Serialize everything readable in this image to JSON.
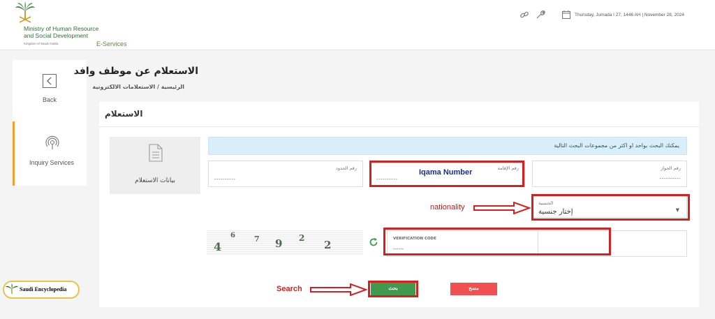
{
  "header": {
    "ministry_line1": "Ministry of Human Resource",
    "ministry_line2": "and Social Development",
    "ministry_sub": "Kingdom of Saudi Arabia",
    "eservices": "E-Services",
    "date": "Thursday, Jumada I 27, 1446 AH | November 28, 2024"
  },
  "sidebar": {
    "back_label": "Back",
    "inquiry_label": "Inquiry Services"
  },
  "page": {
    "title": "الاستعلام عن موظف وافد",
    "breadcrumb": "الرئيسية / الاستعلامات الالكترونية"
  },
  "panel": {
    "title": "الاستعلام",
    "data_box_label": "بيانات الاستعلام",
    "info_text": "يمكنك البحث بواحد او اكثر من مجموعات البحث التالية",
    "fields": {
      "passport_label": "رقم الجواز",
      "passport_value": "----------",
      "iqama_label": "رقم الإقامة",
      "iqama_value": "----------",
      "border_label": "رقم الحدود",
      "border_value": "----------",
      "nationality_label": "الجنسية",
      "nationality_value": "إختار جنسية"
    },
    "captcha_chars": [
      "4",
      "6",
      "7",
      "9",
      "2",
      "2"
    ],
    "verification_label": "VERIFICATION CODE",
    "verification_value": "------",
    "search_button": "بحث",
    "clear_button": "مسح"
  },
  "annotations": {
    "iqama": "Iqama Number",
    "nationality": "nationality",
    "search": "Search"
  },
  "badge": {
    "text": "Saudi Encyclopedia"
  },
  "colors": {
    "brand_green": "#2f6e3a",
    "search_button": "#3f9a4e",
    "clear_button": "#f05050",
    "annotation_red": "#d42020",
    "sidebar_accent": "#f0a030"
  }
}
